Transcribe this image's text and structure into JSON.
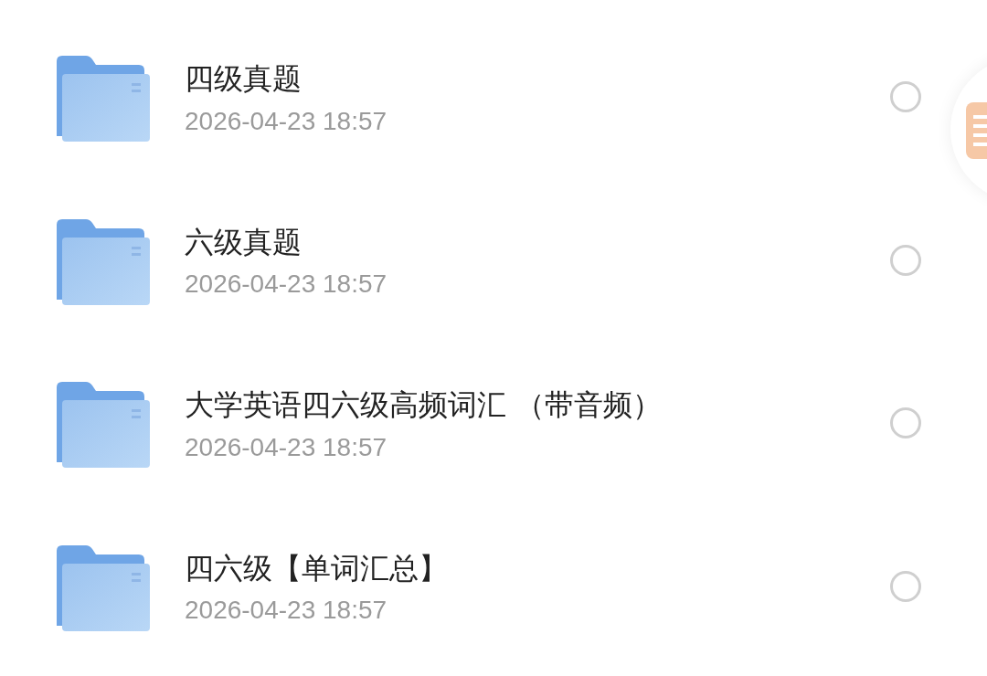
{
  "folders": [
    {
      "name": "四级真题",
      "date": "2026-04-23 18:57",
      "selected": false
    },
    {
      "name": "六级真题",
      "date": "2026-04-23 18:57",
      "selected": false
    },
    {
      "name": "大学英语四六级高频词汇 （带音频）",
      "date": "2026-04-23 18:57",
      "selected": false
    },
    {
      "name": "四六级【单词汇总】",
      "date": "2026-04-23 18:57",
      "selected": false
    }
  ]
}
